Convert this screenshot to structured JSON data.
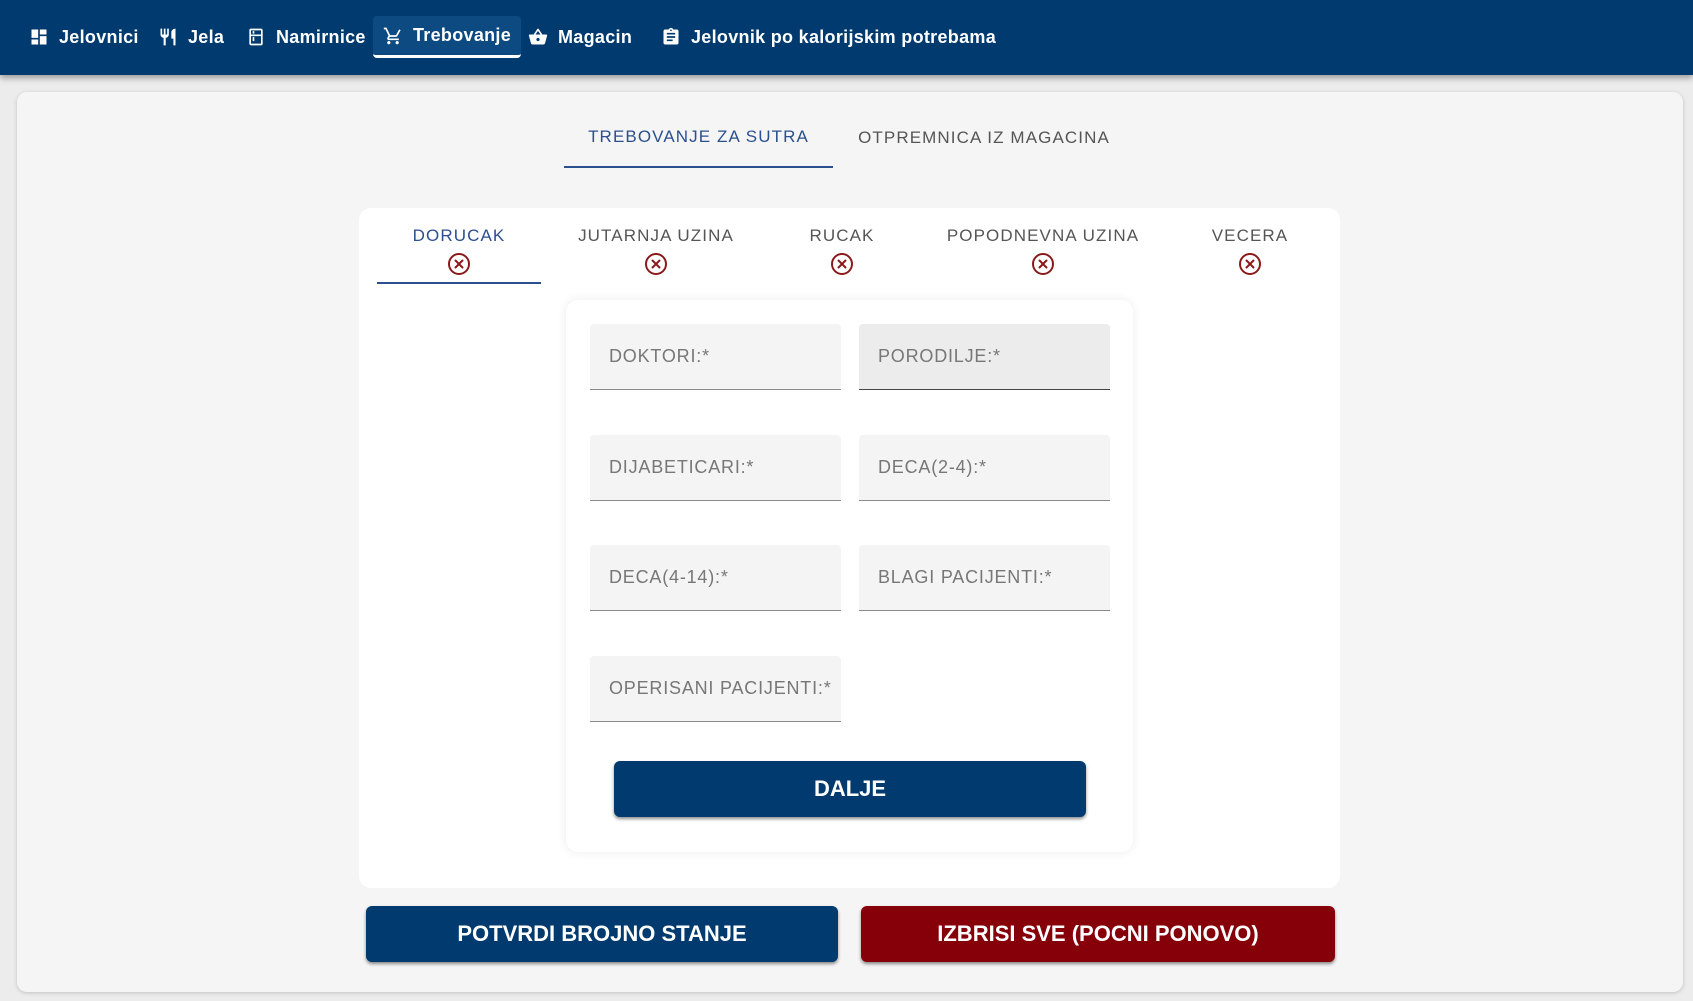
{
  "nav": {
    "items": [
      {
        "label": "Jelovnici",
        "icon": "dashboard-icon"
      },
      {
        "label": "Jela",
        "icon": "restaurant-icon"
      },
      {
        "label": "Namirnice",
        "icon": "kitchen-icon"
      },
      {
        "label": "Trebovanje",
        "icon": "cart-icon",
        "active": true
      },
      {
        "label": "Magacin",
        "icon": "basket-icon"
      },
      {
        "label": "Jelovnik po kalorijskim potrebama",
        "icon": "clipboard-icon"
      }
    ]
  },
  "top_tabs": [
    {
      "label": "TREBOVANJE ZA SUTRA",
      "active": true
    },
    {
      "label": "OTPREMNICA IZ MAGACINA",
      "active": false
    }
  ],
  "meal_tabs": [
    {
      "label": "DORUCAK",
      "icon": "cancel-circle-icon",
      "active": true
    },
    {
      "label": "JUTARNJA UZINA",
      "icon": "cancel-circle-icon"
    },
    {
      "label": "RUCAK",
      "icon": "cancel-circle-icon"
    },
    {
      "label": "POPODNEVNA UZINA",
      "icon": "cancel-circle-icon"
    },
    {
      "label": "VECERA",
      "icon": "cancel-circle-icon"
    }
  ],
  "form": {
    "fields": [
      {
        "placeholder": "DOKTORI:*",
        "value": ""
      },
      {
        "placeholder": "PORODILJE:*",
        "value": ""
      },
      {
        "placeholder": "DIJABETICARI:*",
        "value": ""
      },
      {
        "placeholder": "DECA(2-4):*",
        "value": ""
      },
      {
        "placeholder": "DECA(4-14):*",
        "value": ""
      },
      {
        "placeholder": "BLAGI PACIJENTI:*",
        "value": ""
      },
      {
        "placeholder": "OPERISANI PACIJENTI:*",
        "value": ""
      }
    ],
    "next_label": "DALJE"
  },
  "actions": {
    "confirm_label": "POTVRDI BROJNO STANJE",
    "delete_label": "IZBRISI SVE (POCNI PONOVO)"
  },
  "colors": {
    "brand": "#003a6e",
    "accent_tab": "#2b4f8f",
    "danger": "#850009",
    "icon_cancel": "#8b1a1a"
  }
}
